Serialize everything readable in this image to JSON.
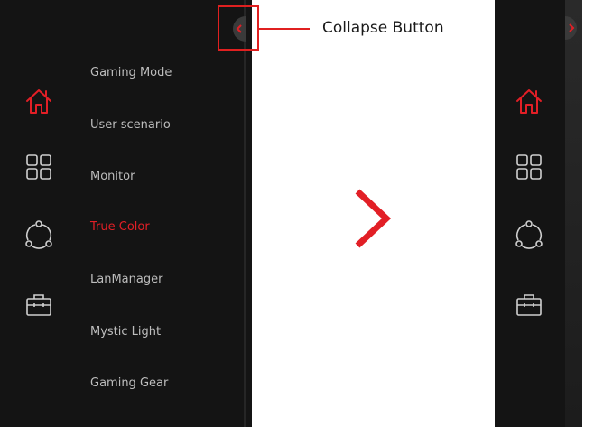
{
  "callout": {
    "label": "Collapse Button"
  },
  "sidebar": {
    "items": [
      {
        "label": "Gaming Mode",
        "active": false
      },
      {
        "label": "User scenario",
        "active": false
      },
      {
        "label": "Monitor",
        "active": false
      },
      {
        "label": "True Color",
        "active": true
      },
      {
        "label": "LanManager",
        "active": false
      },
      {
        "label": "Mystic Light",
        "active": false
      },
      {
        "label": "Gaming Gear",
        "active": false
      }
    ],
    "icons": [
      "home-icon",
      "grid-icon",
      "share-nodes-icon",
      "toolbox-icon"
    ]
  },
  "colors": {
    "accent": "#e21f26",
    "panel": "#141414",
    "text": "#bdbdbd",
    "icon": "#cfcfcf"
  }
}
